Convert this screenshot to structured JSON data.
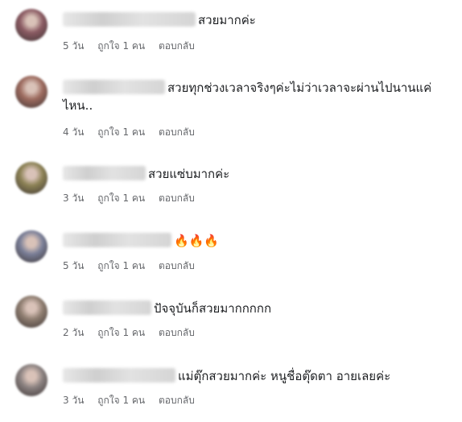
{
  "comments": [
    {
      "text": "สวยมากค่ะ",
      "time": "5 วัน",
      "likes": "ถูกใจ 1 คน",
      "reply": "ตอบกลับ",
      "avatar_color": "#8a5a62"
    },
    {
      "text": "สวยทุกช่วงเวลาจริงๆค่ะไม่ว่าเวลาจะผ่านไปนานแค่ไหน..",
      "time": "4 วัน",
      "likes": "ถูกใจ 1 คน",
      "reply": "ตอบกลับ",
      "avatar_color": "#9c6a5e"
    },
    {
      "text": "สวยแซ่บมากค่ะ",
      "time": "3 วัน",
      "likes": "ถูกใจ 1 คน",
      "reply": "ตอบกลับ",
      "avatar_color": "#8b8154"
    },
    {
      "text": "🔥🔥🔥",
      "time": "5 วัน",
      "likes": "ถูกใจ 1 คน",
      "reply": "ตอบกลับ",
      "avatar_color": "#7a7f98"
    },
    {
      "text": "ปัจจุบันก็สวยมากกกกก",
      "time": "2 วัน",
      "likes": "ถูกใจ 1 คน",
      "reply": "ตอบกลับ",
      "avatar_color": "#8e7d70"
    },
    {
      "text": "แม่ตุ๊กสวยมากค่ะ หนูชื่อตุ๊ดตา อายเลยค่ะ",
      "time": "3 วัน",
      "likes": "ถูกใจ 1 คน",
      "reply": "ตอบกลับ",
      "avatar_color": "#8a8180"
    }
  ]
}
